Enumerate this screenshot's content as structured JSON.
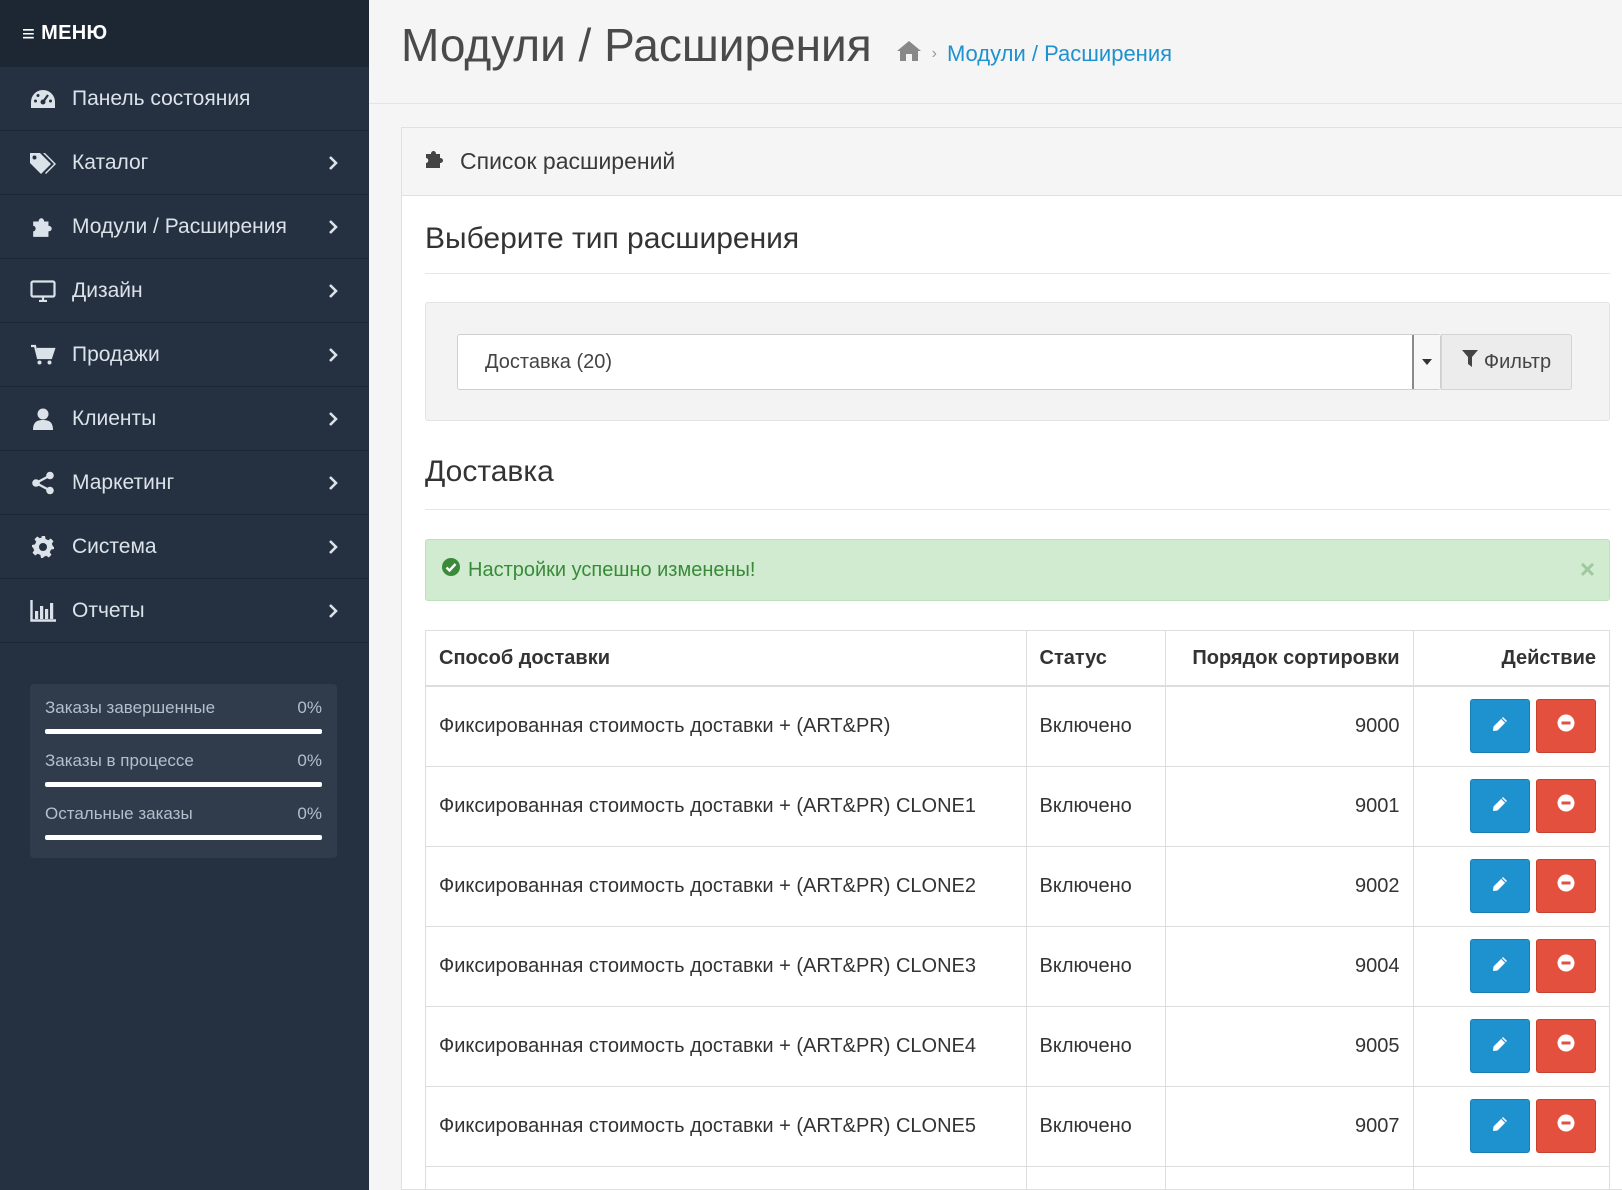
{
  "sidebar": {
    "menu_label": "МЕНЮ",
    "items": [
      {
        "label": "Панель состояния",
        "icon": "dashboard-icon",
        "has_children": false
      },
      {
        "label": "Каталог",
        "icon": "tags-icon",
        "has_children": true
      },
      {
        "label": "Модули / Расширения",
        "icon": "puzzle-icon",
        "has_children": true
      },
      {
        "label": "Дизайн",
        "icon": "monitor-icon",
        "has_children": true
      },
      {
        "label": "Продажи",
        "icon": "cart-icon",
        "has_children": true
      },
      {
        "label": "Клиенты",
        "icon": "user-icon",
        "has_children": true
      },
      {
        "label": "Маркетинг",
        "icon": "share-icon",
        "has_children": true
      },
      {
        "label": "Система",
        "icon": "gear-icon",
        "has_children": true
      },
      {
        "label": "Отчеты",
        "icon": "bar-chart-icon",
        "has_children": true
      }
    ],
    "stats": [
      {
        "label": "Заказы завершенные",
        "value": "0%",
        "progress": 0
      },
      {
        "label": "Заказы в процессе",
        "value": "0%",
        "progress": 0
      },
      {
        "label": "Остальные заказы",
        "value": "0%",
        "progress": 0
      }
    ]
  },
  "header": {
    "title": "Модули / Расширения",
    "breadcrumb_separator": "›",
    "breadcrumb_link": "Модули / Расширения"
  },
  "panel": {
    "title": "Список расширений",
    "choose_type_heading": "Выберите тип расширения",
    "select_value": "Доставка (20)",
    "filter_label": "Фильтр",
    "section_heading": "Доставка",
    "alert_text": "Настройки успешно изменены!",
    "alert_close": "×"
  },
  "table": {
    "columns": [
      "Способ доставки",
      "Статус",
      "Порядок сортировки",
      "Действие"
    ],
    "rows": [
      {
        "name": "Фиксированная стоимость доставки + (ART&PR)",
        "status": "Включено",
        "sort": "9000"
      },
      {
        "name": "Фиксированная стоимость доставки + (ART&PR) CLONE1",
        "status": "Включено",
        "sort": "9001"
      },
      {
        "name": "Фиксированная стоимость доставки + (ART&PR) CLONE2",
        "status": "Включено",
        "sort": "9002"
      },
      {
        "name": "Фиксированная стоимость доставки + (ART&PR) CLONE3",
        "status": "Включено",
        "sort": "9004"
      },
      {
        "name": "Фиксированная стоимость доставки + (ART&PR) CLONE4",
        "status": "Включено",
        "sort": "9005"
      },
      {
        "name": "Фиксированная стоимость доставки + (ART&PR) CLONE5",
        "status": "Включено",
        "sort": "9007"
      },
      {
        "name": "",
        "status": "",
        "sort": ""
      }
    ]
  },
  "colors": {
    "sidebar_bg": "#253140",
    "accent_blue": "#1e91cf",
    "danger_red": "#e3503e",
    "success_bg": "#d0ebcf"
  }
}
